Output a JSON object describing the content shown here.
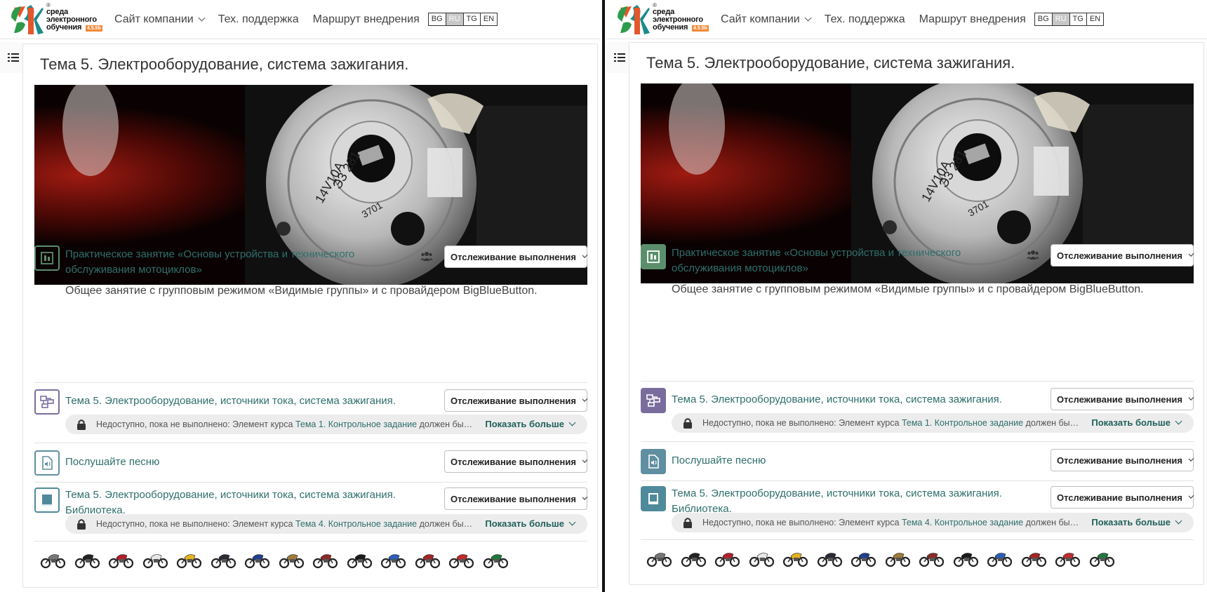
{
  "header": {
    "logo": {
      "reg": "®",
      "lines": [
        "среда",
        "электронного",
        "обучения"
      ],
      "version": "4.5.5b"
    },
    "nav": [
      {
        "label": "Сайт компании",
        "dropdown": true
      },
      {
        "label": "Тех. поддержка",
        "dropdown": false
      },
      {
        "label": "Маршрут внедрения",
        "dropdown": false
      }
    ],
    "languages": [
      "BG",
      "RU",
      "TG",
      "EN"
    ],
    "active_language": "RU"
  },
  "section": {
    "title": "Тема 5. Электрооборудование, система зажигания.",
    "activities": [
      {
        "icon": "bigbluebutton-icon",
        "link_line1": "Практическое занятие «Основы устройства и технического",
        "link_line2": "обслуживания мотоциклов»",
        "description": "Общее занятие с групповым режимом «Видимые группы» и с провайдером BigBlueButton.",
        "tracking": "Отслеживание выполнения"
      },
      {
        "icon": "lesson-icon",
        "link_line1": "Тема 5. Электрооборудование, источники тока, система зажигания.",
        "tracking": "Отслеживание выполнения",
        "restriction": {
          "prefix": "Недоступно, пока не выполнено: Элемент курса ",
          "link": "Тема 1. Контрольное задание",
          "suffix": " должен быть отмечен как выполненный",
          "more": "Показать больше"
        }
      },
      {
        "icon": "audio-file-icon",
        "link_line1": "Послушайте песню",
        "tracking": "Отслеживание выполнения"
      },
      {
        "icon": "book-icon",
        "link_line1": "Тема 5. Электрооборудование, источники тока, система зажигания.",
        "link_line2": "Библиотека.",
        "tracking": "Отслеживание выполнения",
        "restriction": {
          "prefix": "Недоступно, пока не выполнено: Элемент курса ",
          "link": "Тема 4. Контрольное задание",
          "suffix": " должен быть отмечен как выполненный",
          "more": "Показать больше"
        }
      }
    ],
    "motorcycle_colors": [
      "#777777",
      "#222222",
      "#b3202a",
      "#e8e8e8",
      "#e3b21c",
      "#2b2b35",
      "#1f3f8f",
      "#a07a3a",
      "#8c2a28",
      "#1a1a1a",
      "#2a5fb8",
      "#a32525",
      "#c12b2b",
      "#1f7a3a"
    ]
  },
  "colors": {
    "link": "#2f6f6c",
    "bbb_icon": "#5b8f6b",
    "lesson_icon": "#7a6d9e",
    "file_icon": "#5f8fa0",
    "book_icon": "#4f8a9a"
  }
}
